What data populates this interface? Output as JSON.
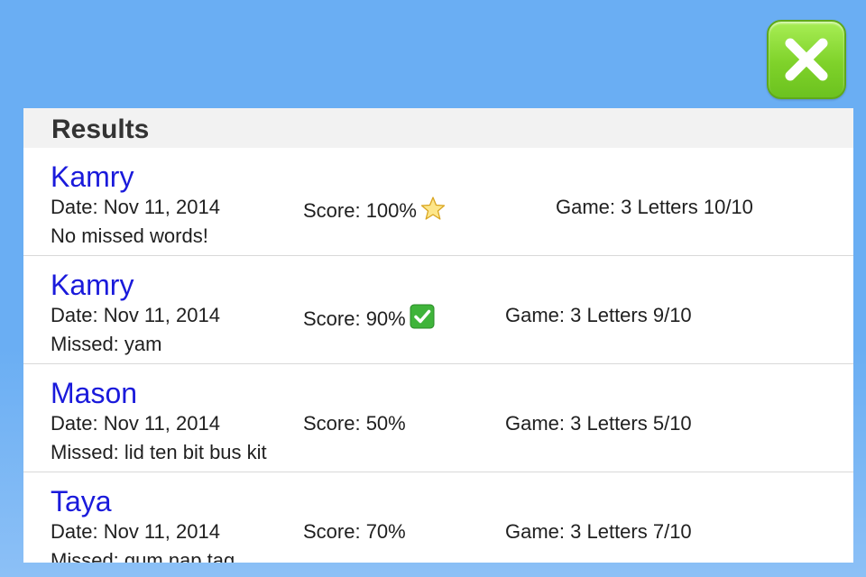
{
  "header": {
    "title": "Results"
  },
  "close_button": {
    "icon": "close-x-icon",
    "color": "#7fd22a"
  },
  "colors": {
    "background": "#6aaef3",
    "name_link": "#1a1adb"
  },
  "results": [
    {
      "name": "Kamry",
      "date": "Date: Nov 11, 2014",
      "score": "Score: 100%",
      "badge": "star-icon",
      "game": "Game: 3 Letters 10/10",
      "missed": "No missed words!"
    },
    {
      "name": "Kamry",
      "date": "Date: Nov 11, 2014",
      "score": "Score: 90%",
      "badge": "checkmark-icon",
      "game": "Game: 3 Letters 9/10",
      "missed": "Missed: yam"
    },
    {
      "name": "Mason",
      "date": "Date: Nov 11, 2014",
      "score": "Score: 50%",
      "badge": "",
      "game": "Game: 3 Letters 5/10",
      "missed": "Missed: lid ten bit bus kit"
    },
    {
      "name": "Taya",
      "date": "Date: Nov 11, 2014",
      "score": "Score: 70%",
      "badge": "",
      "game": "Game: 3 Letters 7/10",
      "missed": "Missed: gum nap tag"
    }
  ]
}
